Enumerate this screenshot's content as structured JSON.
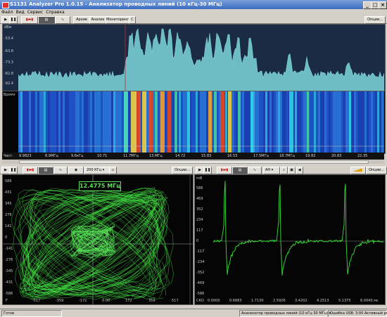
{
  "window": {
    "title": "S1131 Analyzer Pro 1.0.15 - Анализатор проводных линий (10 кГц-30 МГц)",
    "min": "_",
    "max": "□",
    "close": "×"
  },
  "menu": [
    "Файл",
    "Вид",
    "Сервис",
    "Справка"
  ],
  "top_toolbar": {
    "buttons": [
      "Архив",
      "Анализ",
      "Мониторинг",
      "С"
    ],
    "options_label": "Опции..."
  },
  "spectrum": {
    "unit": "dBм",
    "y_ticks": [
      "-53.4",
      "-63.8",
      "-73.3",
      "-82.8",
      "-92.4"
    ],
    "waterfall_label": "Время",
    "x_ticks": [
      "9.9823",
      "8.9МГц",
      "9.6кГц",
      "10.71",
      "11.7МГц",
      "13.МГц",
      "14.72",
      "15.83",
      "16.53",
      "17.5МГц",
      "18.7МГц",
      "19.82",
      "20.83",
      "22.35"
    ],
    "freq_label": "Част.",
    "colors": {
      "trace": "#7fd3d6",
      "waterfall_base": "#1a3fb0",
      "hot": "#e8421c"
    }
  },
  "left_panel": {
    "toolbar_select": "200 КГц",
    "options_label": "Опции...",
    "readout": "12.4775 МГц",
    "y_ticks": [
      "586",
      "431",
      "345",
      "276",
      "141",
      "0",
      "-141",
      "-276",
      "-345",
      "-431",
      "-586"
    ],
    "x_ticks": [
      "-517",
      "-359",
      "-172",
      "0.00",
      "172",
      "359",
      "517"
    ],
    "axis_letter": "F"
  },
  "right_panel": {
    "toolbar_select": "АН",
    "options_label": "Опции...",
    "unit": "mB",
    "y_ticks": [
      "586",
      "469",
      "352",
      "234",
      "117",
      "0",
      "-117",
      "-234",
      "-352",
      "-469",
      "-586"
    ],
    "x_ticks": [
      "0.0000",
      "0.6683",
      "1.7130",
      "2.5926",
      "3.4202",
      "4.2513",
      "5.1375",
      "6.0040 мс"
    ],
    "corner_label": "СКО"
  },
  "statusbar": {
    "left": "Готов",
    "mode": "Анализатор проводных линий (10 кГц-30 МГц)",
    "right": "Ошибка USB: 3:00 Активный режим"
  }
}
